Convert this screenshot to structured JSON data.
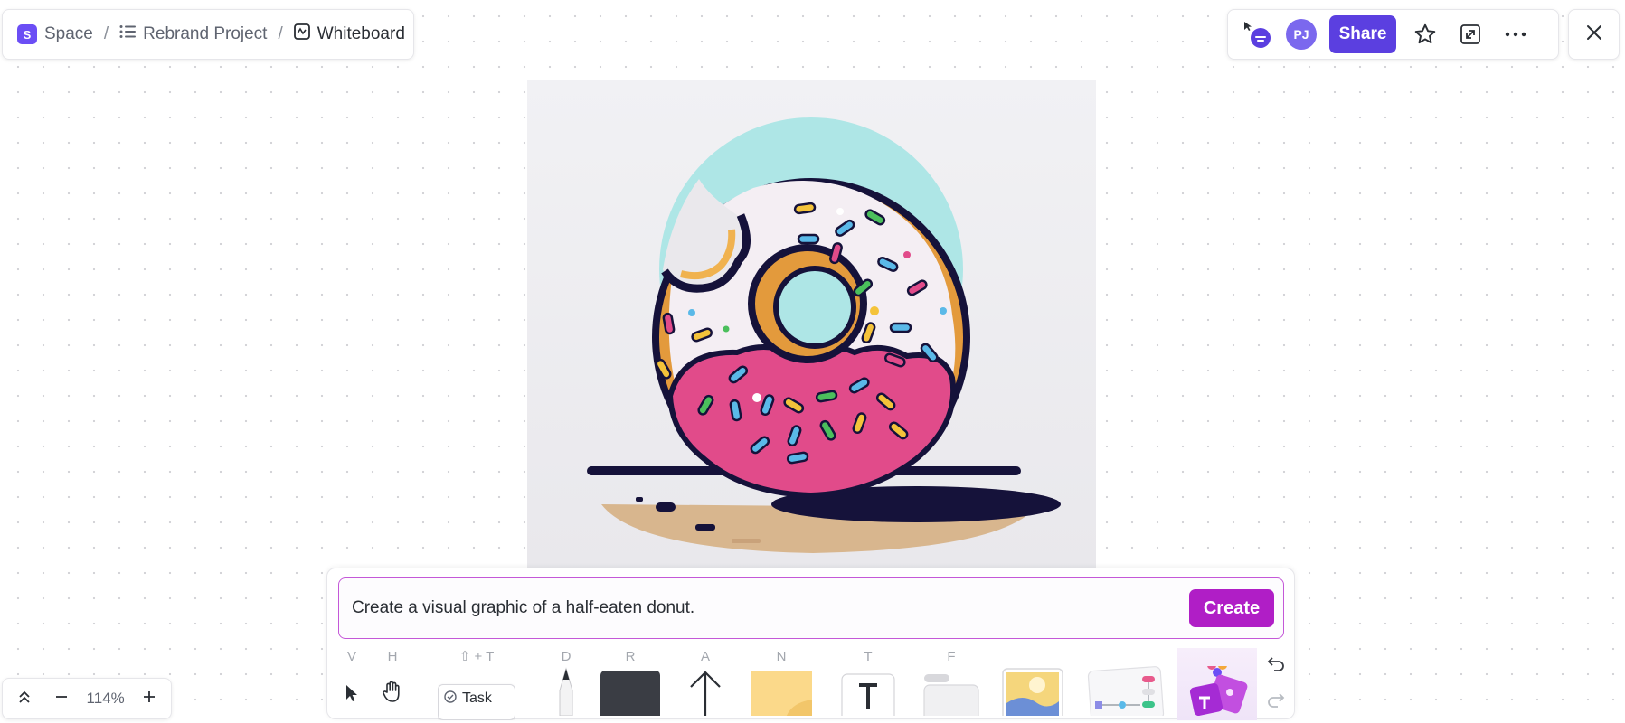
{
  "breadcrumb": {
    "space_badge": "S",
    "space": "Space",
    "separator": "/",
    "project": "Rebrand Project",
    "page": "Whiteboard"
  },
  "topbar": {
    "avatar_initials": "PJ",
    "share_label": "Share"
  },
  "image": {
    "subject": "half-eaten donut graphic"
  },
  "prompt": {
    "value": "Create a visual graphic of a half-eaten donut.",
    "create_label": "Create"
  },
  "tools": {
    "select_key": "V",
    "hand_key": "H",
    "task_key": "⇧ + T",
    "task_label": "Task",
    "draw_key": "D",
    "rectangle_key": "R",
    "arrow_key": "A",
    "note_key": "N",
    "text_key": "T",
    "frame_key": "F"
  },
  "zoom": {
    "value": "114%"
  },
  "colors": {
    "brand": "#5b3fe0",
    "create": "#b01ec6",
    "prompt_border": "#c458d8"
  }
}
